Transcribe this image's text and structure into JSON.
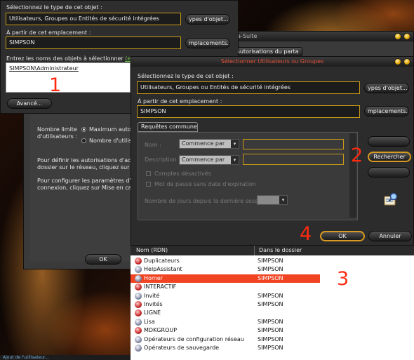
{
  "win1": {
    "object_type_label": "Sélectionnez le type de cet objet :",
    "object_type_value": "Utilisateurs, Groupes ou Entités de sécurité intégrées",
    "types_btn": "ypes d'objet...",
    "location_label": "À partir de cet emplacement :",
    "location_value": "SIMPSON",
    "locations_btn": "mplacements...",
    "names_label": "Entrez les noms des objets à sélectionner",
    "names_link": "(exemple",
    "names_value": "SIMPSON\\Administrateur",
    "advanced_btn": "Avancé...",
    "annotation": "1"
  },
  "win2": {
    "title": "Autorisations pour Za-Suite",
    "tab": "Autorisations du parta",
    "limit_label_1": "Nombre limite",
    "limit_label_2": "d'utilisateurs :",
    "radio_max": "Maximum autorisé",
    "radio_count": "Nombre d'utilisateurs",
    "para1_line1": "Pour définir les autorisations d'accès à",
    "para1_line2": "dossier sur le réseau, cliquez sur Autori",
    "para2_line1": "Pour configurer les paramètres d'accès",
    "para2_line2": "connexion, cliquez sur Mise en cache",
    "ok": "OK"
  },
  "win3": {
    "title": "Sélectionner Utilisateurs ou Groupes",
    "object_type_label": "Sélectionnez le type de cet objet :",
    "object_type_value": "Utilisateurs, Groupes ou Entités de sécurité intégrées",
    "types_btn": "ypes d'objet...",
    "location_label": "À partir de cet emplacement :",
    "location_value": "SIMPSON",
    "locations_btn": "mplacements...",
    "tab_common": "Requêtes communes",
    "name_label": "Nom :",
    "desc_label": "Description :",
    "starts_with": "Commence par",
    "disabled_accounts": "Comptes désactivés",
    "no_expire": "Mot de passe sans date d'expiration",
    "days_since": "Nombre de jours depuis la dernière session :",
    "search_btn": "Rechercher",
    "ok": "OK",
    "cancel": "Annuler",
    "annotation_search": "2",
    "annotation_ok": "4"
  },
  "results": {
    "col_name": "Nom (RDN)",
    "col_folder": "Dans le dossier",
    "annotation": "3",
    "rows": [
      {
        "name": "Duplicateurs",
        "folder": "SIMPSON",
        "selected": false
      },
      {
        "name": "HelpAssistant",
        "folder": "SIMPSON",
        "selected": false
      },
      {
        "name": "Homer",
        "folder": "SIMPSON",
        "selected": true
      },
      {
        "name": "INTERACTIF",
        "folder": "",
        "selected": false
      },
      {
        "name": "Invité",
        "folder": "SIMPSON",
        "selected": false
      },
      {
        "name": "Invités",
        "folder": "SIMPSON",
        "selected": false
      },
      {
        "name": "LIGNE",
        "folder": "",
        "selected": false
      },
      {
        "name": "Lisa",
        "folder": "SIMPSON",
        "selected": false
      },
      {
        "name": "MDKGROUP",
        "folder": "SIMPSON",
        "selected": false
      },
      {
        "name": "Opérateurs de configuration réseau",
        "folder": "SIMPSON",
        "selected": false
      },
      {
        "name": "Opérateurs de sauvegarde",
        "folder": "SIMPSON",
        "selected": false
      }
    ]
  },
  "taskbar": {
    "label": "Ajout de l'utilisateur..."
  },
  "colors": {
    "accent_border": "#c89a18",
    "selection": "#f04422",
    "annotation": "#ff2a10",
    "title_active": "#e05038"
  },
  "icons": [
    "user-icon",
    "group-icon",
    "search-list-icon",
    "dropdown-arrow-icon"
  ]
}
